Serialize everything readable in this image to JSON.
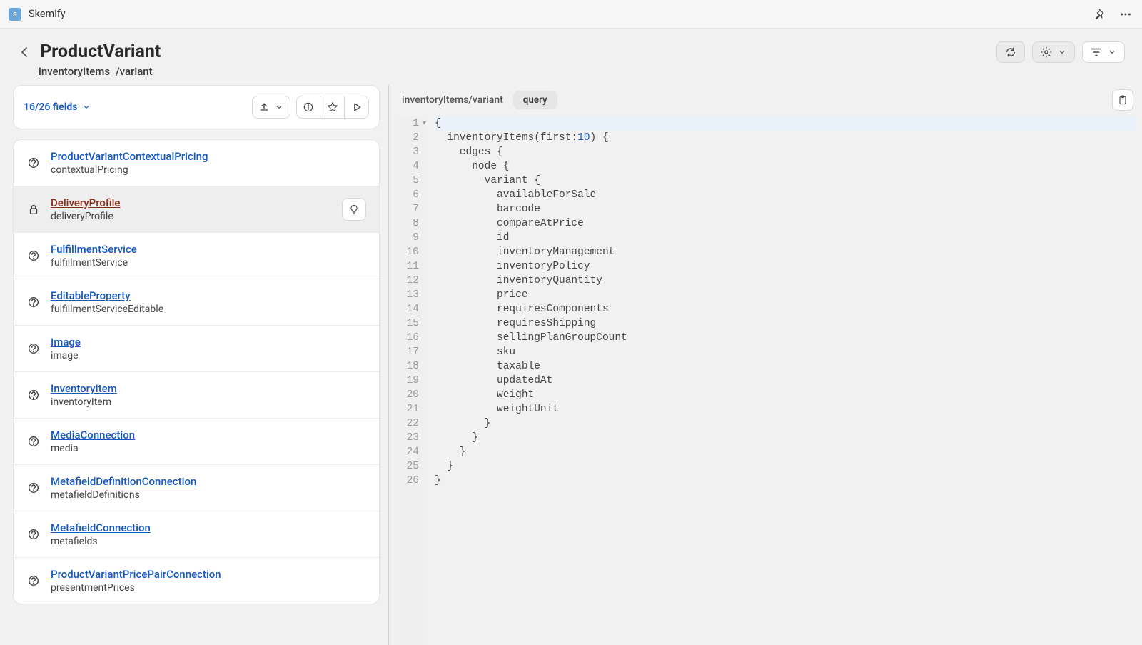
{
  "app": {
    "title": "Skemify"
  },
  "header": {
    "title": "ProductVariant",
    "breadcrumb_link": "inventoryItems",
    "breadcrumb_rest": "/variant"
  },
  "fields_toolbar": {
    "count_label": "16/26 fields"
  },
  "fields": [
    {
      "icon": "question",
      "type": "ProductVariantContextualPricing",
      "name": "contextualPricing",
      "selected": false
    },
    {
      "icon": "lock",
      "type": "DeliveryProfile",
      "name": "deliveryProfile",
      "selected": true,
      "trailing_hint": true
    },
    {
      "icon": "question",
      "type": "FulfillmentService",
      "name": "fulfillmentService",
      "selected": false
    },
    {
      "icon": "question",
      "type": "EditableProperty",
      "name": "fulfillmentServiceEditable",
      "selected": false
    },
    {
      "icon": "question",
      "type": "Image",
      "name": "image",
      "selected": false
    },
    {
      "icon": "question",
      "type": "InventoryItem",
      "name": "inventoryItem",
      "selected": false
    },
    {
      "icon": "question",
      "type": "MediaConnection",
      "name": "media",
      "selected": false
    },
    {
      "icon": "question",
      "type": "MetafieldDefinitionConnection",
      "name": "metafieldDefinitions",
      "selected": false
    },
    {
      "icon": "question",
      "type": "MetafieldConnection",
      "name": "metafields",
      "selected": false
    },
    {
      "icon": "question",
      "type": "ProductVariantPricePairConnection",
      "name": "presentmentPrices",
      "selected": false
    }
  ],
  "query": {
    "path_label": "inventoryItems/variant",
    "tab_label": "query",
    "lines": [
      {
        "n": 1,
        "fold": true,
        "txt_a": "{",
        "txt_b": "",
        "txt_c": ""
      },
      {
        "n": 2,
        "fold": false,
        "txt_a": "  inventoryItems(first:",
        "txt_b": "10",
        "txt_c": ") {"
      },
      {
        "n": 3,
        "fold": false,
        "txt_a": "    edges {",
        "txt_b": "",
        "txt_c": ""
      },
      {
        "n": 4,
        "fold": false,
        "txt_a": "      node {",
        "txt_b": "",
        "txt_c": ""
      },
      {
        "n": 5,
        "fold": false,
        "txt_a": "        variant {",
        "txt_b": "",
        "txt_c": ""
      },
      {
        "n": 6,
        "fold": false,
        "txt_a": "          availableForSale",
        "txt_b": "",
        "txt_c": ""
      },
      {
        "n": 7,
        "fold": false,
        "txt_a": "          barcode",
        "txt_b": "",
        "txt_c": ""
      },
      {
        "n": 8,
        "fold": false,
        "txt_a": "          compareAtPrice",
        "txt_b": "",
        "txt_c": ""
      },
      {
        "n": 9,
        "fold": false,
        "txt_a": "          id",
        "txt_b": "",
        "txt_c": ""
      },
      {
        "n": 10,
        "fold": false,
        "txt_a": "          inventoryManagement",
        "txt_b": "",
        "txt_c": ""
      },
      {
        "n": 11,
        "fold": false,
        "txt_a": "          inventoryPolicy",
        "txt_b": "",
        "txt_c": ""
      },
      {
        "n": 12,
        "fold": false,
        "txt_a": "          inventoryQuantity",
        "txt_b": "",
        "txt_c": ""
      },
      {
        "n": 13,
        "fold": false,
        "txt_a": "          price",
        "txt_b": "",
        "txt_c": ""
      },
      {
        "n": 14,
        "fold": false,
        "txt_a": "          requiresComponents",
        "txt_b": "",
        "txt_c": ""
      },
      {
        "n": 15,
        "fold": false,
        "txt_a": "          requiresShipping",
        "txt_b": "",
        "txt_c": ""
      },
      {
        "n": 16,
        "fold": false,
        "txt_a": "          sellingPlanGroupCount",
        "txt_b": "",
        "txt_c": ""
      },
      {
        "n": 17,
        "fold": false,
        "txt_a": "          sku",
        "txt_b": "",
        "txt_c": ""
      },
      {
        "n": 18,
        "fold": false,
        "txt_a": "          taxable",
        "txt_b": "",
        "txt_c": ""
      },
      {
        "n": 19,
        "fold": false,
        "txt_a": "          updatedAt",
        "txt_b": "",
        "txt_c": ""
      },
      {
        "n": 20,
        "fold": false,
        "txt_a": "          weight",
        "txt_b": "",
        "txt_c": ""
      },
      {
        "n": 21,
        "fold": false,
        "txt_a": "          weightUnit",
        "txt_b": "",
        "txt_c": ""
      },
      {
        "n": 22,
        "fold": false,
        "txt_a": "        }",
        "txt_b": "",
        "txt_c": ""
      },
      {
        "n": 23,
        "fold": false,
        "txt_a": "      }",
        "txt_b": "",
        "txt_c": ""
      },
      {
        "n": 24,
        "fold": false,
        "txt_a": "    }",
        "txt_b": "",
        "txt_c": ""
      },
      {
        "n": 25,
        "fold": false,
        "txt_a": "  }",
        "txt_b": "",
        "txt_c": ""
      },
      {
        "n": 26,
        "fold": false,
        "txt_a": "}",
        "txt_b": "",
        "txt_c": ""
      }
    ]
  }
}
